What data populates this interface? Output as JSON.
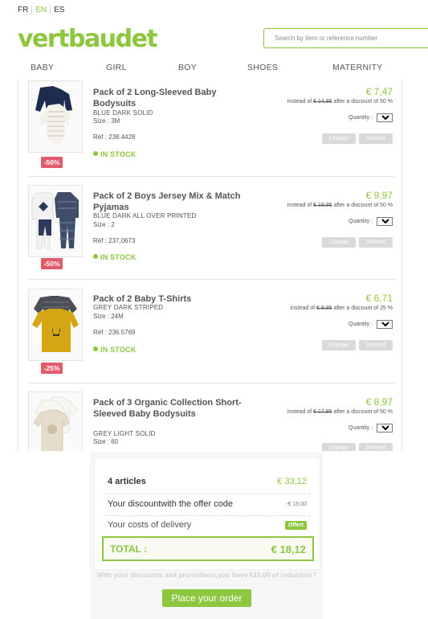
{
  "languages": [
    "FR",
    "EN",
    "ES"
  ],
  "active_language": "EN",
  "logo": "vertbaudet",
  "search": {
    "placeholder": "Search by item or reference number"
  },
  "nav": [
    "BABY",
    "GIRL",
    "BOY",
    "SHOES",
    "MATERNITY"
  ],
  "items": [
    {
      "name": "Pack of 2 Long-Sleeved Baby Bodysuits",
      "variant": "BLUE DARK SOLID",
      "size": "Size : 3M",
      "ref": "Réf : 238.4428",
      "stock": "IN STOCK",
      "price": "€ 7,47",
      "instead_prefix": "instead of ",
      "old_price": "€ 14,95",
      "instead_suffix": " after a discount of 50 %",
      "qty_label": "Quantity :",
      "qty": "1",
      "discount": "-50%",
      "change": "Change",
      "delete": "Deleted"
    },
    {
      "name": "Pack of 2 Boys Jersey Mix & Match Pyjamas",
      "variant": "BLUE DARK ALL OVER PRINTED",
      "size": "Size : 2",
      "ref": "Réf : 237,0673",
      "stock": "IN STOCK",
      "price": "€ 9,97",
      "instead_prefix": "instead of ",
      "old_price": "€ 19,95",
      "instead_suffix": " after a discount of 50 %",
      "qty_label": "Quantity :",
      "qty": "1",
      "discount": "-50%",
      "change": "Change",
      "delete": "Deleted"
    },
    {
      "name": "Pack of 2 Baby T-Shirts",
      "variant": "GREY DARK STRIPED",
      "size": "Size : 24M",
      "ref": "Réf : 236.5769",
      "stock": "IN STOCK",
      "price": "€ 6,71",
      "instead_prefix": "instead of ",
      "old_price": "€ 8,95",
      "instead_suffix": " after a discount of 25 %",
      "qty_label": "Quantity :",
      "qty": "1",
      "discount": "-25%",
      "change": "Change",
      "delete": "Deleted"
    },
    {
      "name": "Pack of 3 Organic Collection Short-Sleeved Baby Bodysuits",
      "variant": "GREY LIGHT SOLID",
      "size": "Size : 60",
      "ref": "",
      "stock": "",
      "price": "€ 8,97",
      "instead_prefix": "instead of ",
      "old_price": "€ 17,95",
      "instead_suffix": " after a discount of 50 %",
      "qty_label": "Quantity :",
      "qty": "1",
      "discount": "",
      "change": "Change",
      "delete": "Deleted"
    }
  ],
  "summary": {
    "articles_label": "4 articles",
    "articles_value": "€ 33,12",
    "discount_label": "Your discountwith the offer code",
    "discount_value": "-€ 15,00",
    "delivery_label": "Your costs of delivery",
    "delivery_value": "Offert",
    "total_label": "TOTAL :",
    "total_value": "€ 18,12"
  },
  "promo_text": "With your discounts and promotions,you have €15.00 of reduction !",
  "order_button": "Place your order",
  "colors": {
    "accent": "#8dc63f",
    "discount_badge": "#e35a6b",
    "disabled_button": "#d9d9d9"
  }
}
